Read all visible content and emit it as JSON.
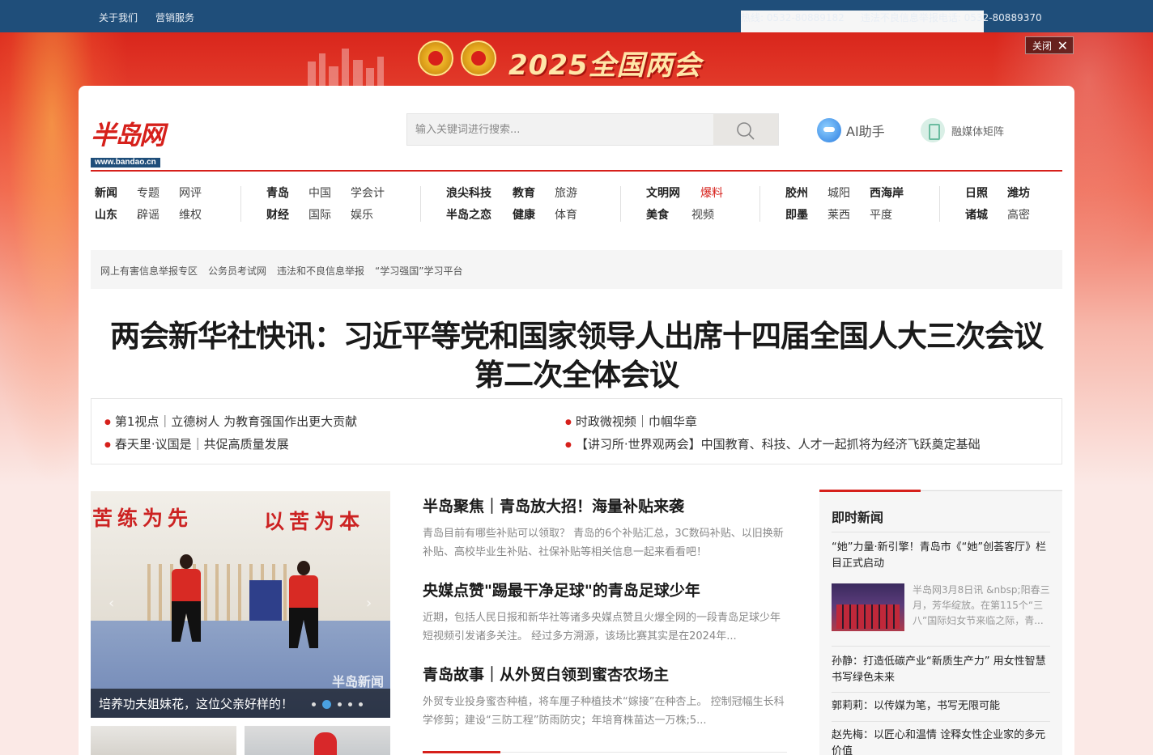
{
  "topbar": {
    "about": "关于我们",
    "marketing": "营销服务",
    "hotline": "热线: 0532-80889182",
    "report": "违法不良信息举报电话: 0532-80889370"
  },
  "banner": {
    "title": "2025全国两会",
    "close_label": "关闭"
  },
  "logo": {
    "text": "半岛网",
    "url": "www.bandao.cn"
  },
  "search": {
    "placeholder": "输入关键词进行搜索..."
  },
  "ai": {
    "label": "AI助手"
  },
  "media": {
    "label": "融媒体矩阵"
  },
  "nav": {
    "g1": {
      "r1": [
        "新闻",
        "专题",
        "网评"
      ],
      "r2": [
        "山东",
        "辟谣",
        "维权"
      ]
    },
    "g2": {
      "r1": [
        "青岛",
        "中国",
        "学会计"
      ],
      "r2": [
        "财经",
        "国际",
        "娱乐"
      ]
    },
    "g3": {
      "r1": [
        "浪尖科技",
        "教育",
        "旅游"
      ],
      "r2": [
        "半岛之恋",
        "健康",
        "体育"
      ]
    },
    "g4": {
      "r1": [
        "文明网",
        "爆料"
      ],
      "r2": [
        "美食",
        "视频"
      ]
    },
    "g5": {
      "r1": [
        "胶州",
        "城阳",
        "西海岸"
      ],
      "r2": [
        "即墨",
        "莱西",
        "平度"
      ]
    },
    "g6": {
      "r1": [
        "日照",
        "潍坊"
      ],
      "r2": [
        "诸城",
        "高密"
      ]
    }
  },
  "quick_links": [
    "网上有害信息举报专区",
    "公务员考试网",
    "违法和不良信息举报",
    "“学习强国”学习平台"
  ],
  "headline": {
    "line1": "两会新华社快讯：习近平等党和国家领导人出席十四届全国人大三次会议",
    "line2": "第二次全体会议"
  },
  "sublinks": [
    "第1视点｜立德树人 为教育强国作出更大贡献",
    "时政微视频｜巾帼华章",
    "春天里·议国是｜共促高质量发展",
    "【讲习所·世界观两会】中国教育、科技、人才一起抓将为经济飞跃奠定基础"
  ],
  "feature": {
    "slogan_left": "苦练为先",
    "slogan_right": "以苦为本",
    "caption": "培养功夫姐妹花，这位父亲好样的！",
    "watermark": "半岛新闻",
    "slide_count": 5,
    "active_slide": 2
  },
  "articles": [
    {
      "title": "半岛聚焦｜青岛放大招！海量补贴来袭",
      "summary": "青岛目前有哪些补贴可以领取？ 青岛的6个补贴汇总，3C数码补贴、以旧换新补贴、高校毕业生补贴、社保补贴等相关信息一起来看看吧！"
    },
    {
      "title": "央媒点赞\"踢最干净足球\"的青岛足球少年",
      "summary": "近期，包括人民日报和新华社等诸多央媒点赞且火爆全网的一段青岛足球少年短视频引发诸多关注。 经过多方溯源，该场比赛其实是在2024年..."
    },
    {
      "title": "青岛故事｜从外贸白领到蜜杏农场主",
      "summary": "外贸专业投身蜜杏种植，将车厘子种植技术“嫁接”在种杏上。 控制冠幅生长科学修剪；建设“三防工程”防雨防灾；年培育株苗达一万株;5..."
    }
  ],
  "instant_news": {
    "title": "即时新闻",
    "top": "“她”力量·新引擎！青岛市《“她”创荟客厅》栏目正式启动",
    "pic_summary": "半岛网3月8日讯 &nbsp;阳春三月，芳华绽放。在第115个“三八”国际妇女节来临之际，青...",
    "items": [
      "孙静：打造低碳产业“新质生产力” 用女性智慧书写绿色未来",
      "郭莉莉：以传媒为笔，书写无限可能",
      "赵先梅：以匠心和温情 诠释女性企业家的多元价值"
    ]
  },
  "colors": {
    "brand_red": "#d6201b",
    "topbar_blue": "#1f4e7a"
  }
}
